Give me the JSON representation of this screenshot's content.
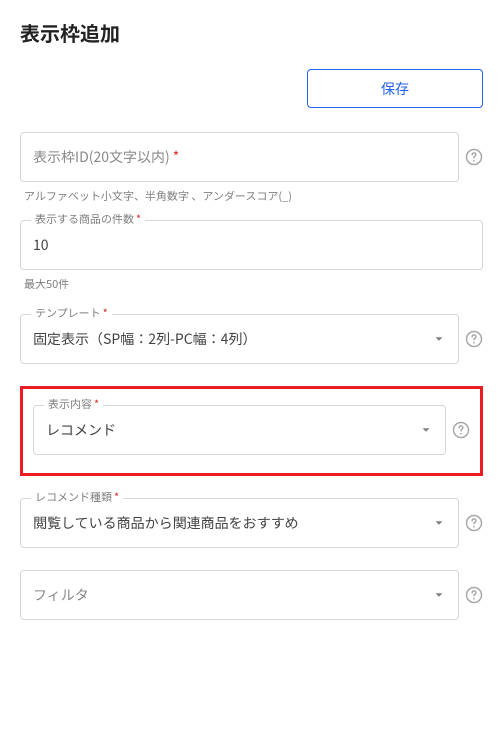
{
  "page": {
    "title": "表示枠追加",
    "save_label": "保存"
  },
  "fields": {
    "slot_id": {
      "label": "表示枠ID(20文字以内)",
      "required_mark": "*",
      "hint": "アルファベット小文字、半角数字 、アンダースコア(_)"
    },
    "item_count": {
      "label": "表示する商品の件数",
      "required_mark": "*",
      "value": "10",
      "hint": "最大50件"
    },
    "template": {
      "label": "テンプレート",
      "required_mark": "*",
      "value": "固定表示（SP幅：2列-PC幅：4列）"
    },
    "content": {
      "label": "表示内容",
      "required_mark": "*",
      "value": "レコメンド"
    },
    "recommend_type": {
      "label": "レコメンド種類",
      "required_mark": "*",
      "value": "閲覧している商品から関連商品をおすすめ"
    },
    "filter": {
      "label": "フィルタ",
      "value": ""
    }
  }
}
